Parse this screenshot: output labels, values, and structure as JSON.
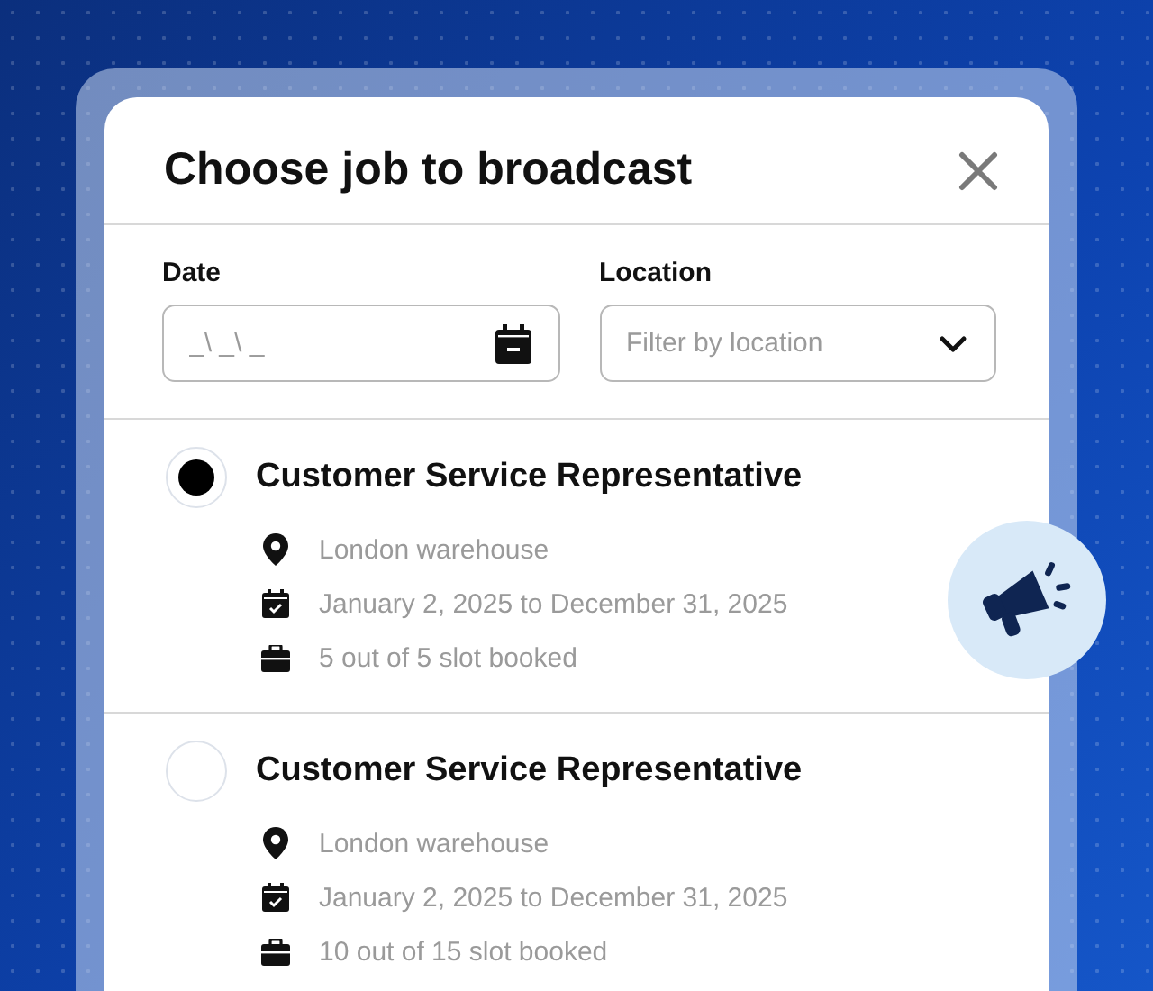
{
  "dialog": {
    "title": "Choose job to broadcast"
  },
  "filters": [
    {
      "kind": "date",
      "label": "Date",
      "placeholder": "_\\ _\\ _"
    },
    {
      "kind": "select",
      "label": "Location",
      "placeholder": "Filter by location"
    }
  ],
  "jobs": [
    {
      "title": "Customer Service Representative",
      "selected": true,
      "location": "London warehouse",
      "dates": "January 2, 2025 to December 31, 2025",
      "slots": "5 out of 5 slot booked"
    },
    {
      "title": "Customer Service Representative",
      "selected": false,
      "location": "London warehouse",
      "dates": "January 2, 2025 to December 31, 2025",
      "slots": "10 out of 15 slot booked"
    }
  ]
}
